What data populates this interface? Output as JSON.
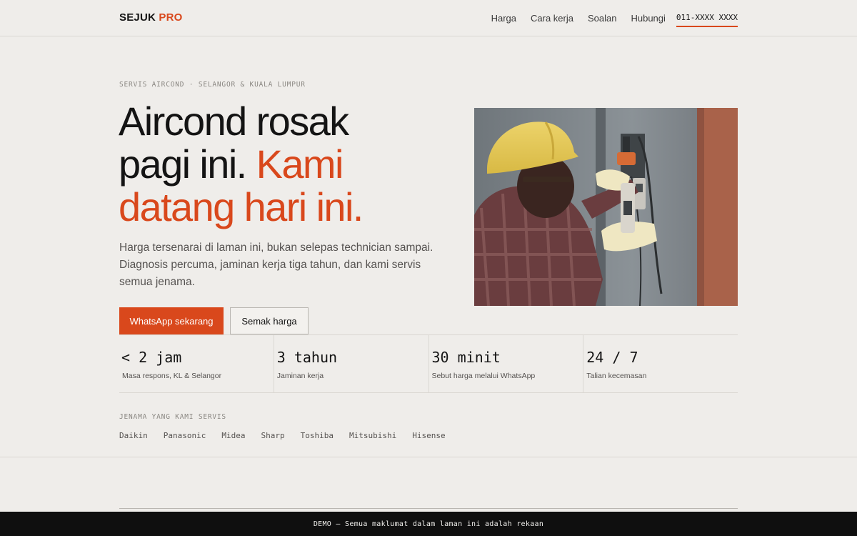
{
  "header": {
    "logo_main": "SEJUK",
    "logo_accent": "PRO",
    "nav": [
      {
        "label": "Harga"
      },
      {
        "label": "Cara kerja"
      },
      {
        "label": "Soalan"
      },
      {
        "label": "Hubungi"
      }
    ],
    "phone": "011-XXXX XXXX"
  },
  "hero": {
    "eyebrow": "SERVIS AIRCOND · SELANGOR & KUALA LUMPUR",
    "headline_line1": "Aircond rosak",
    "headline_line2a": "pagi ini.",
    "headline_line2b": "Kami",
    "headline_line3": "datang hari ini.",
    "lead": "Harga tersenarai di laman ini, bukan selepas technician sampai. Diagnosis percuma, jaminan kerja tiga tahun, dan kami servis semua jenama.",
    "cta_primary": "WhatsApp sekarang",
    "cta_secondary": "Semak harga"
  },
  "stats": [
    {
      "value": "< 2 jam",
      "label": "Masa respons, KL & Selangor"
    },
    {
      "value": "3 tahun",
      "label": "Jaminan kerja"
    },
    {
      "value": "30 minit",
      "label": "Sebut harga melalui WhatsApp"
    },
    {
      "value": "24 / 7",
      "label": "Talian kecemasan"
    }
  ],
  "brands": {
    "title": "JENAMA YANG KAMI SERVIS",
    "items": [
      "Daikin",
      "Panasonic",
      "Midea",
      "Sharp",
      "Toshiba",
      "Mitsubishi",
      "Hisense"
    ]
  },
  "demo_notice": "DEMO — Semua maklumat dalam laman ini adalah rekaan",
  "colors": {
    "accent": "#d9481c",
    "background": "#efedea",
    "text": "#141414"
  }
}
